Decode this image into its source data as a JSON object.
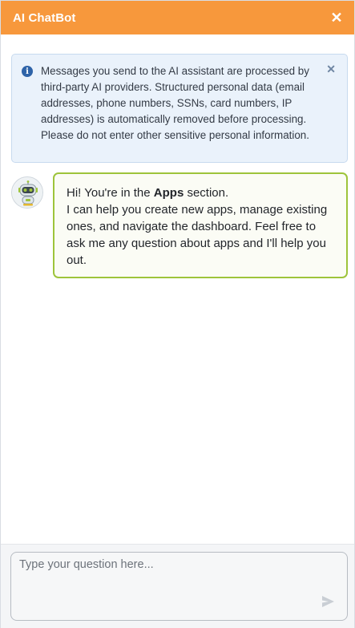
{
  "header": {
    "title": "AI ChatBot",
    "close_glyph": "✕",
    "background": "#f7983c"
  },
  "notice": {
    "icon": "info-icon",
    "icon_glyph": "i",
    "text": "Messages you send to the AI assistant are processed by third-party AI providers. Structured personal data (email addresses, phone numbers, SSNs, card numbers, IP addresses) is automatically removed before processing. Please do not enter other sensitive personal information.",
    "close_glyph": "✕"
  },
  "message": {
    "avatar_icon": "robot-icon",
    "greeting_prefix": "Hi! You're in the ",
    "greeting_bold": "Apps",
    "greeting_suffix": " section.",
    "body": "I can help you create new apps, manage existing ones, and navigate the dashboard. Feel free to ask me any question about apps and I'll help you out.",
    "border_color": "#9ec43b"
  },
  "composer": {
    "placeholder": "Type your question here...",
    "value": "",
    "send_icon": "send-icon"
  }
}
